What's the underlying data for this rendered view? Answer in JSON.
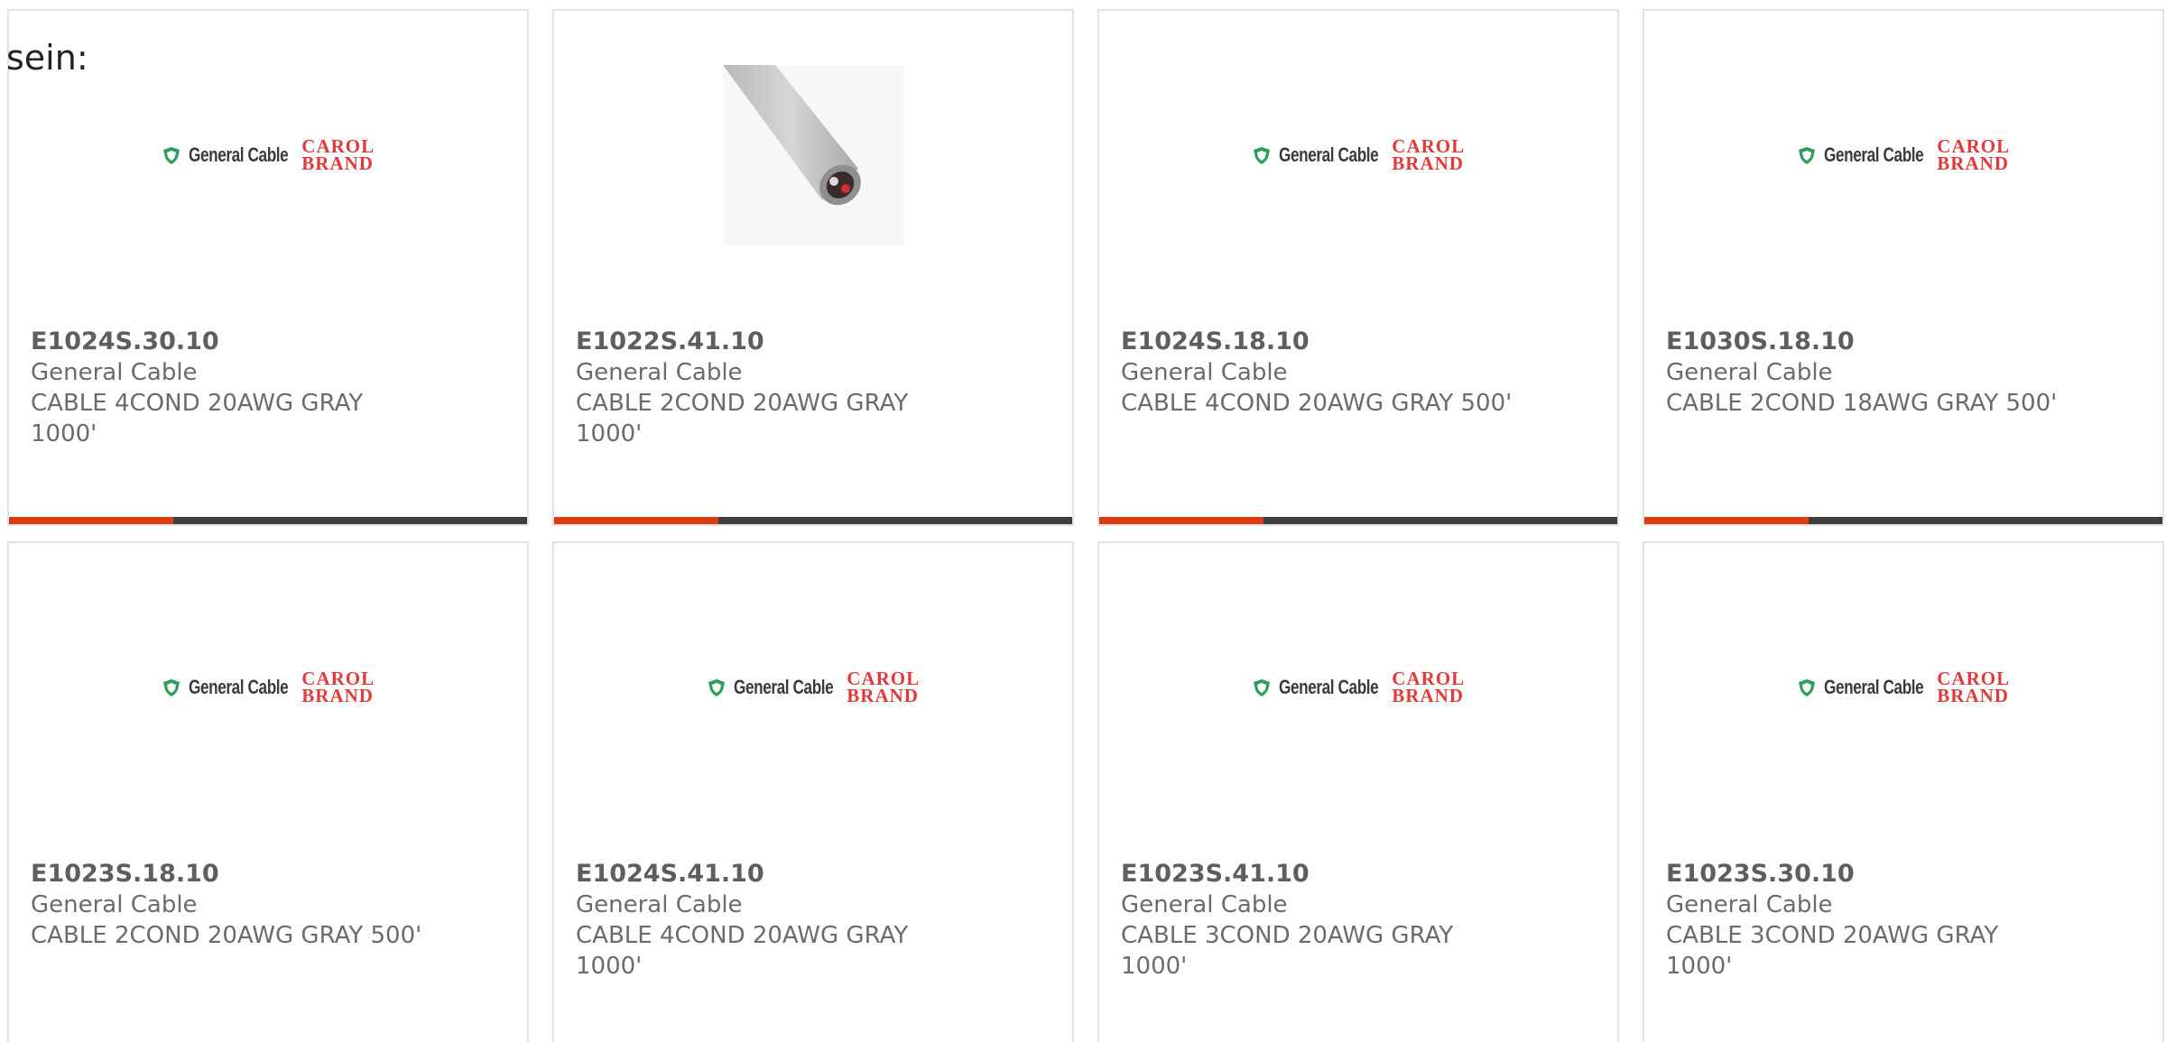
{
  "prefix_text": "sein:",
  "accent_color": "#e03a12",
  "products": [
    {
      "part_number": "E1024S.30.10",
      "brand": "General Cable",
      "description": "CABLE 4COND 20AWG GRAY 1000'",
      "image": "general-cable-carol-brand-logo"
    },
    {
      "part_number": "E1022S.41.10",
      "brand": "General Cable",
      "description": "CABLE 2COND 20AWG GRAY 1000'",
      "image": "gray-cable-photo"
    },
    {
      "part_number": "E1024S.18.10",
      "brand": "General Cable",
      "description": "CABLE 4COND 20AWG GRAY 500'",
      "image": "general-cable-carol-brand-logo"
    },
    {
      "part_number": "E1030S.18.10",
      "brand": "General Cable",
      "description": "CABLE 2COND 18AWG GRAY 500'",
      "image": "general-cable-carol-brand-logo"
    },
    {
      "part_number": "E1023S.18.10",
      "brand": "General Cable",
      "description": "CABLE 2COND 20AWG GRAY 500'",
      "image": "general-cable-carol-brand-logo"
    },
    {
      "part_number": "E1024S.41.10",
      "brand": "General Cable",
      "description": "CABLE 4COND 20AWG GRAY 1000'",
      "image": "general-cable-carol-brand-logo"
    },
    {
      "part_number": "E1023S.41.10",
      "brand": "General Cable",
      "description": "CABLE 3COND 20AWG GRAY 1000'",
      "image": "general-cable-carol-brand-logo"
    },
    {
      "part_number": "E1023S.30.10",
      "brand": "General Cable",
      "description": "CABLE 3COND 20AWG GRAY 1000'",
      "image": "general-cable-carol-brand-logo"
    }
  ],
  "logo_text": {
    "general_cable": "General Cable",
    "carol_line1": "CAROL",
    "carol_line2": "BRAND"
  }
}
